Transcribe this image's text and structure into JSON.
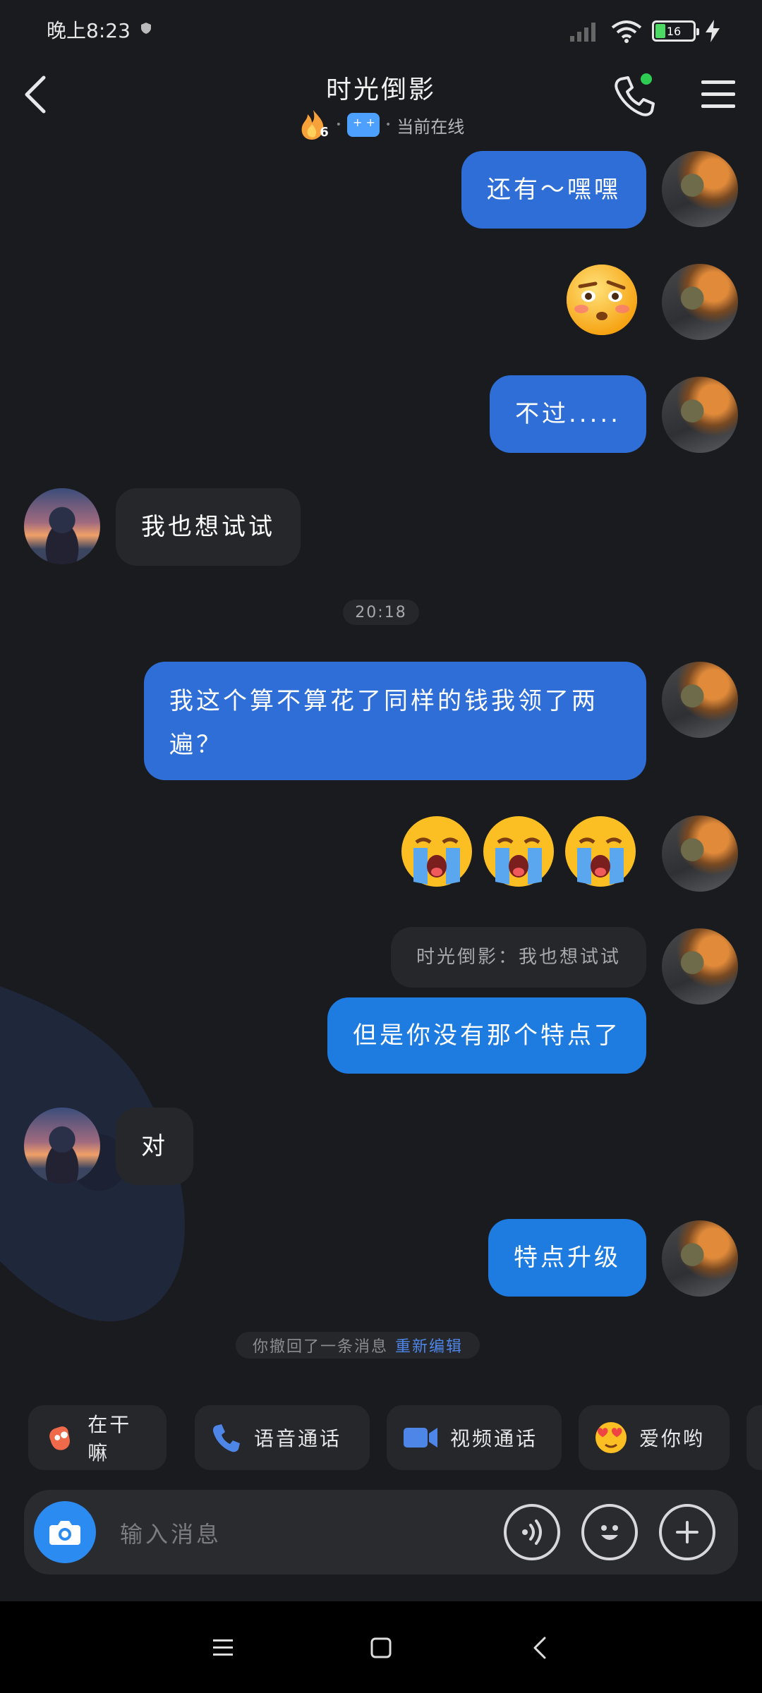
{
  "status_bar": {
    "time": "晚上8:23",
    "battery": "16",
    "colors": {
      "battery_fill": "#4cd964"
    }
  },
  "header": {
    "title": "时光倒影",
    "fire_count": "6",
    "status": "当前在线",
    "icons": [
      "back-icon",
      "fire-icon",
      "game-icon",
      "phone-icon",
      "menu-icon"
    ],
    "colors": {
      "online_dot": "#2ecc52"
    }
  },
  "messages": [
    {
      "from": "me",
      "type": "text",
      "text": "还有～嘿嘿"
    },
    {
      "from": "me",
      "type": "emoji",
      "emoji": "🤨"
    },
    {
      "from": "me",
      "type": "text",
      "text": "不过....."
    },
    {
      "from": "other",
      "type": "text",
      "text": "我也想试试"
    },
    {
      "type": "time",
      "text": "20:18"
    },
    {
      "from": "me",
      "type": "text",
      "text": "我这个算不算花了同样的钱我领了两遍？"
    },
    {
      "from": "me",
      "type": "emoji",
      "emoji": "😭😭😭"
    },
    {
      "from": "me",
      "type": "quote",
      "text": "时光倒影：我也想试试"
    },
    {
      "from": "me",
      "type": "text",
      "text": "但是你没有那个特点了"
    },
    {
      "from": "other",
      "type": "text",
      "text": "对"
    },
    {
      "from": "me",
      "type": "text",
      "text": "特点升级"
    }
  ],
  "recall_notice": {
    "text": "你撤回了一条消息",
    "action": "重新编辑"
  },
  "quick_actions": [
    {
      "label": "在干嘛",
      "icon": "wave-icon"
    },
    {
      "label": "语音通话",
      "icon": "phone-icon"
    },
    {
      "label": "视频通话",
      "icon": "video-icon"
    },
    {
      "label": "爱你哟",
      "icon": "love-emoji-icon"
    }
  ],
  "input": {
    "placeholder": "输入消息",
    "buttons": [
      "camera-icon",
      "voice-icon",
      "emoji-icon",
      "plus-icon"
    ]
  },
  "colors": {
    "background": "#1a1b1f",
    "bubble_me": "#2e6ed6",
    "bubble_other": "#26272b",
    "accent": "#2c8bf0"
  }
}
